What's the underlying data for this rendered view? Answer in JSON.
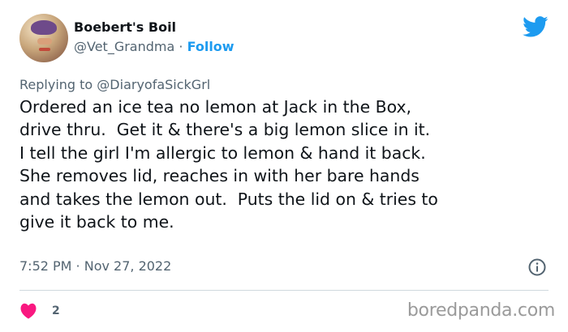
{
  "tweet": {
    "display_name": "Boebert's Boil",
    "handle": "@Vet_Grandma",
    "separator": " · ",
    "follow_label": "Follow",
    "reply_prefix": "Replying to ",
    "reply_to": "@DiaryofaSickGrl",
    "text": "Ordered an ice tea no lemon at Jack in the Box,\ndrive thru.  Get it & there's a big lemon slice in it.\nI tell the girl I'm allergic to lemon & hand it back.\nShe removes lid, reaches in with her bare hands\nand takes the lemon out.  Puts the lid on & tries to\ngive it back to me.",
    "timestamp": "7:52 PM · Nov 27, 2022",
    "like_count": "2"
  },
  "watermark": "boredpanda.com",
  "icons": {
    "brand": "twitter-bird-icon",
    "info": "info-icon",
    "like": "heart-icon"
  },
  "colors": {
    "twitter_blue": "#1d9bf0",
    "like_red": "#f91880",
    "secondary_text": "#536471"
  }
}
